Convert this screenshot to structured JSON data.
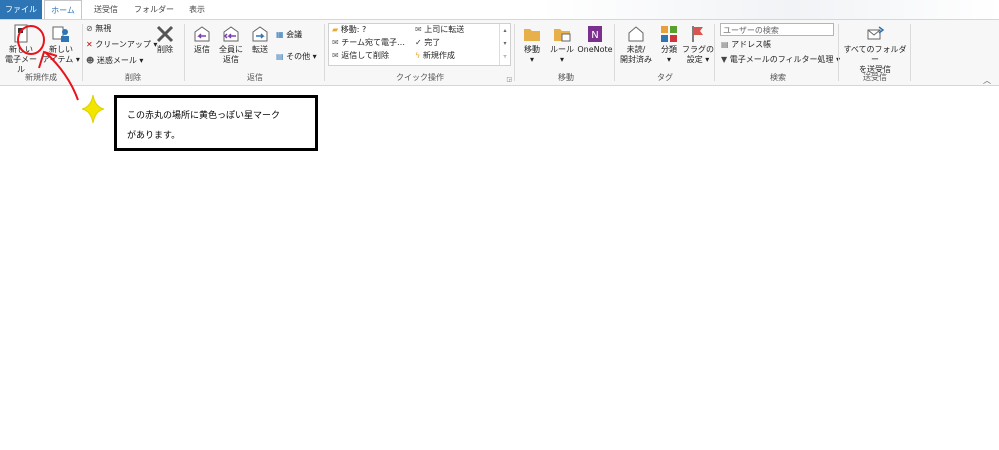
{
  "tabs": {
    "file": "ファイル",
    "home": "ホーム",
    "send_receive": "送受信",
    "folder": "フォルダー",
    "view": "表示"
  },
  "new_group": {
    "new_email_line1": "新しい",
    "new_email_line2": "電子メール",
    "new_items_line1": "新しい",
    "new_items_line2": "アイテム",
    "label": "新規作成"
  },
  "delete_group": {
    "ignore": "無視",
    "cleanup": "クリーンアップ",
    "junk": "迷惑メール",
    "delete": "削除",
    "label": "削除"
  },
  "reply_group": {
    "reply": "返信",
    "reply_all_line1": "全員に",
    "reply_all_line2": "返信",
    "forward": "転送",
    "meeting": "会議",
    "more": "その他",
    "label": "返信"
  },
  "quick_steps": {
    "items": [
      "移動: ?",
      "チーム宛て電子…",
      "返信して削除",
      "上司に転送",
      "完了",
      "新規作成"
    ],
    "label": "クイック操作"
  },
  "move_group": {
    "move": "移動",
    "rules": "ルール",
    "onenote": "OneNote",
    "label": "移動"
  },
  "tags_group": {
    "unread_line1": "未読/",
    "unread_line2": "開封済み",
    "categorize": "分類",
    "followup_line1": "フラグの",
    "followup_line2": "設定",
    "label": "タグ"
  },
  "find_group": {
    "search_placeholder": "ユーザーの検索",
    "address_book": "アドレス帳",
    "filter_email": "電子メールのフィルター処理",
    "label": "検索"
  },
  "sendrecv_group": {
    "all_folders_line1": "すべてのフォルダー",
    "all_folders_line2": "を送受信",
    "label": "送受信"
  },
  "annotation": {
    "line1": "この赤丸の場所に黄色っぽい星マーク",
    "line2": "があります。"
  },
  "colors": {
    "accent": "#2e75b6",
    "annotation_red": "#e8141c",
    "star_yellow": "#f2e600"
  }
}
